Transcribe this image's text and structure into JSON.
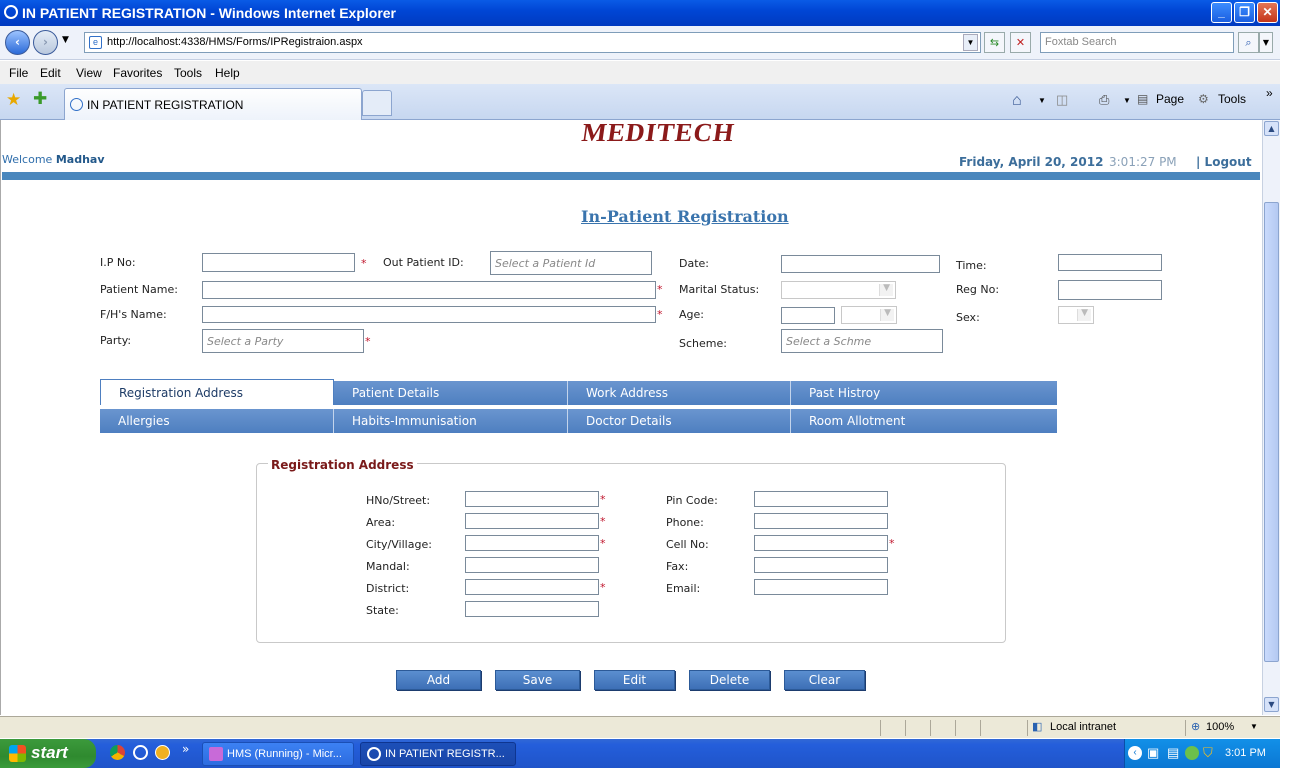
{
  "window": {
    "title": "IN PATIENT REGISTRATION - Windows Internet Explorer",
    "minimize": "_",
    "restore": "❐",
    "close": "✕"
  },
  "browser": {
    "url": "http://localhost:4338/HMS/Forms/IPRegistraion.aspx",
    "search_placeholder": "Foxtab Search",
    "menu": [
      "File",
      "Edit",
      "View",
      "Favorites",
      "Tools",
      "Help"
    ],
    "tab_title": "IN PATIENT REGISTRATION",
    "cmd_page": "Page",
    "cmd_tools": "Tools",
    "status_zone": "Local intranet",
    "zoom": "100%"
  },
  "header": {
    "logo_text": "MEDITECH",
    "welcome_prefix": "Welcome",
    "user": "Madhav",
    "date": "Friday, April 20, 2012",
    "time": "3:01:27 PM",
    "logout": "| Logout"
  },
  "form": {
    "title": "In-Patient Registration",
    "labels": {
      "ip_no": "I.P No:",
      "out_patient_id": "Out Patient ID:",
      "date": "Date:",
      "time": "Time:",
      "patient_name": "Patient Name:",
      "marital_status": "Marital Status:",
      "reg_no": "Reg No:",
      "fh_name": "F/H's Name:",
      "age": "Age:",
      "sex": "Sex:",
      "party": "Party:",
      "scheme": "Scheme:"
    },
    "placeholders": {
      "out_patient_id": "Select a Patient Id",
      "party": "Select a Party",
      "scheme": "Select a Schme"
    },
    "required_mark": "*"
  },
  "tabs": {
    "row1": [
      "Registration Address",
      "Patient Details",
      "Work Address",
      "Past Histroy"
    ],
    "row2": [
      "Allergies",
      "Habits-Immunisation",
      "Doctor Details",
      "Room Allotment"
    ]
  },
  "address": {
    "legend": "Registration Address",
    "labels": {
      "hno": "HNo/Street:",
      "area": "Area:",
      "city": "City/Village:",
      "mandal": "Mandal:",
      "district": "District:",
      "state": "State:",
      "pin": "Pin Code:",
      "phone": "Phone:",
      "cell": "Cell No:",
      "fax": "Fax:",
      "email": "Email:"
    }
  },
  "buttons": [
    "Add",
    "Save",
    "Edit",
    "Delete",
    "Clear"
  ],
  "taskbar": {
    "start": "start",
    "items": [
      "HMS (Running) - Micr...",
      "IN PATIENT REGISTR..."
    ],
    "clock": "3:01 PM"
  },
  "colors": {
    "accent": "#4a87bd",
    "title_blue": "#3a74ad",
    "tab_blue": "#5784c4",
    "required_red": "#c0152c",
    "logo_red": "#8b1a1a"
  }
}
